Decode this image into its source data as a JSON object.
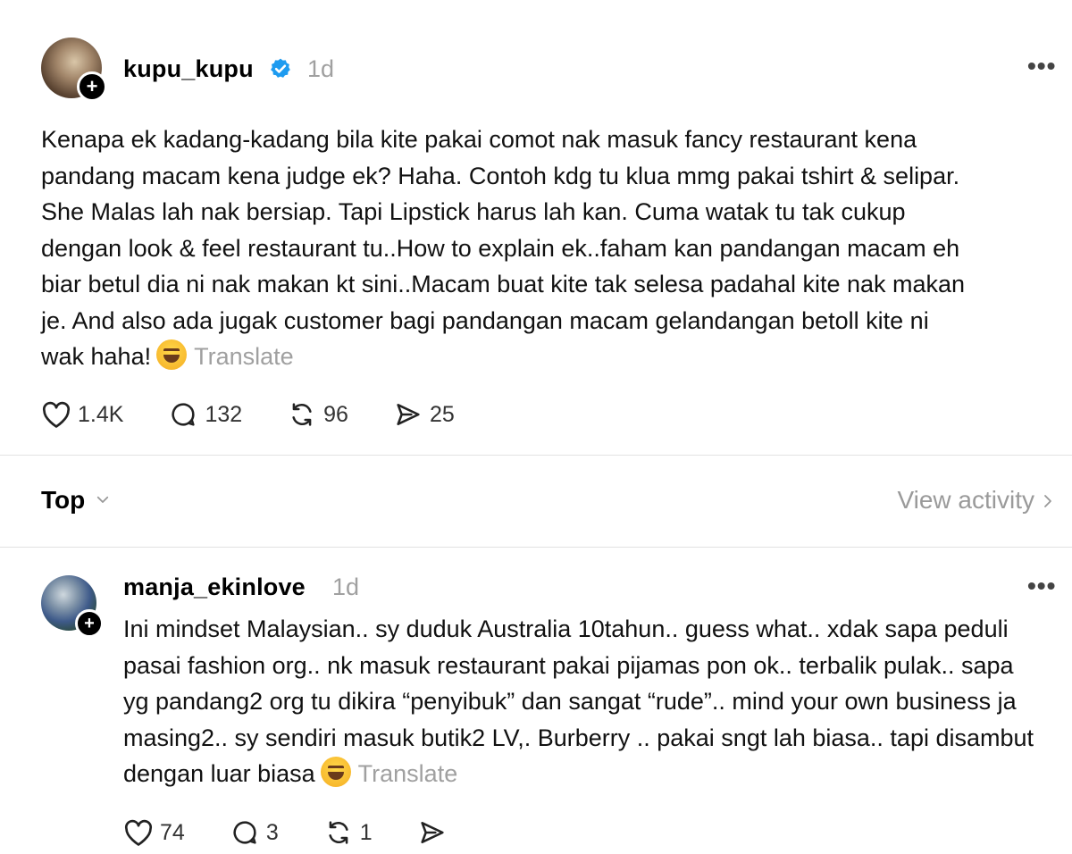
{
  "post": {
    "username": "kupu_kupu",
    "verified": true,
    "time": "1d",
    "text": "Kenapa ek kadang-kadang bila kite pakai comot nak masuk fancy restaurant kena pandang macam kena judge ek? Haha. Contoh kdg tu klua mmg pakai tshirt & selipar. She Malas lah nak bersiap. Tapi Lipstick harus lah kan. Cuma watak tu tak cukup dengan look & feel restaurant tu..How to explain ek..faham kan pandangan macam eh biar betul dia ni nak makan kt sini..Macam buat kite tak selesa padahal kite nak makan je. And also ada jugak customer bagi pandangan macam gelandangan betoll kite ni wak haha!",
    "emoji": "rolling-on-floor-laughing-emoji",
    "translate_label": "Translate",
    "likes": "1.4K",
    "comments": "132",
    "reposts": "96",
    "shares": "25"
  },
  "sort": {
    "label": "Top",
    "view_activity": "View activity"
  },
  "reply": {
    "username": "manja_ekinlove",
    "time": "1d",
    "text": "Ini mindset Malaysian.. sy duduk Australia 10tahun.. guess what.. xdak sapa peduli pasai fashion org.. nk masuk restaurant pakai pijamas pon ok.. terbalik pulak.. sapa yg pandang2 org tu dikira “penyibuk” dan sangat “rude”.. mind your own business ja masing2.. sy sendiri masuk butik2 LV,. Burberry .. pakai sngt lah biasa.. tapi disambut dengan luar biasa",
    "emoji": "tears-of-joy-emoji",
    "translate_label": "Translate",
    "likes": "74",
    "comments": "3",
    "reposts": "1"
  },
  "colors": {
    "verified_badge": "#1d9bf0",
    "muted_text": "#a0a0a0",
    "divider": "#e2e2e2"
  }
}
